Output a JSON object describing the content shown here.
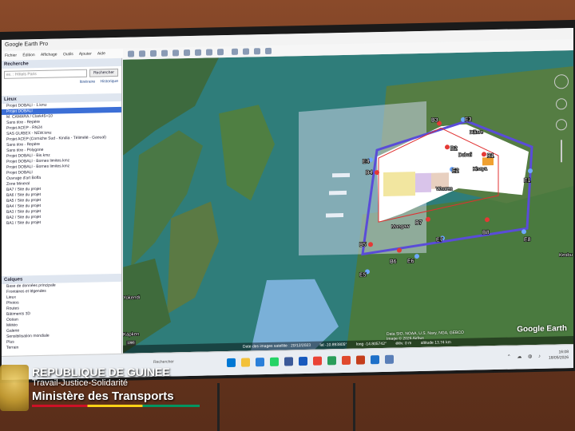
{
  "window": {
    "title": "Google Earth Pro",
    "menus": [
      "Fichier",
      "Édition",
      "Affichage",
      "Outils",
      "Ajouter",
      "Aide"
    ]
  },
  "sidebar": {
    "search_header": "Recherche",
    "search_button": "Rechercher",
    "search_placeholder": "ex. : Hôtels Paris",
    "links": [
      "Itinéraire",
      "Historique"
    ],
    "places_header": "Lieux",
    "places": [
      "Projet DOBALI - 1.kmz",
      "Projet DOBALI",
      "M. CAMARA / Clark45+10",
      "Sans titre - Repère",
      "Projet ACEP - RN24",
      "SAS GUIBEX - NEW.kmz",
      "Projet ACEP (Corniche Sud - Kindia - Télimélé - Gaoual)",
      "Sans titre - Repère",
      "Sans titre - Polygone",
      "Projet DOBALI - Bis.kmz",
      "Projet DOBALI - Bornes limites.kmz",
      "Projet DOBALI - Bornes limites.kmz",
      "Projet DOBALI",
      "Ouvrage d'art Boffa",
      "Zone Mineral",
      "BA7 / Site du projet",
      "BA6 / Site du projet",
      "BA5 / Site du projet",
      "BA4 / Site du projet",
      "BA3 / Site du projet",
      "BA2 / Site du projet",
      "BA1 / Site du projet"
    ],
    "layers_header": "Calques",
    "layers": [
      "Base de données principale",
      "Frontières et légendes",
      "Lieux",
      "Photos",
      "Routes",
      "Bâtiments 3D",
      "Océan",
      "Météo",
      "Galerie",
      "Sensibilisation mondiale",
      "Plus",
      "Terrain"
    ]
  },
  "map": {
    "markers": [
      "B1",
      "B2",
      "B3",
      "B4",
      "B5",
      "B6",
      "B7",
      "B8",
      "E1",
      "E2",
      "E3",
      "E4",
      "E5",
      "E6",
      "E7",
      "E8"
    ],
    "towns": [
      "Diliare",
      "Dobali",
      "Kisoya",
      "Mangaw",
      "Wauren",
      "Kesbu",
      "Kapken",
      "Yokendi"
    ],
    "copyright_lines": [
      "Data SIO, NOAA, U.S. Navy, NGA, GEBCO",
      "Image © 2026 Airbus"
    ],
    "status": {
      "date": "Date des images satellite : 20/12/2023",
      "lat": "lat -10.893805°",
      "lon": "long -14.805742°",
      "elev": "élév. 0 m",
      "alt": "altitude 13.74 km"
    },
    "logo": "Google Earth",
    "zoom_badge": "1986"
  },
  "taskbar": {
    "time": "16:08",
    "date": "18/05/2026",
    "search_hint": "Rechercher"
  },
  "banner": {
    "line1": "REPUBLIQUE DE GUINEE",
    "line2": "Travail-Justice-Solidarité",
    "line3": "Ministère des Transports"
  },
  "colors": {
    "wall": "#6b3a22",
    "boundary": "#5a4cd8",
    "site_fill": "#ffffff",
    "selection": "#3c6fd6",
    "flag_red": "#ce1126",
    "flag_yellow": "#fcd116",
    "flag_green": "#009460"
  }
}
